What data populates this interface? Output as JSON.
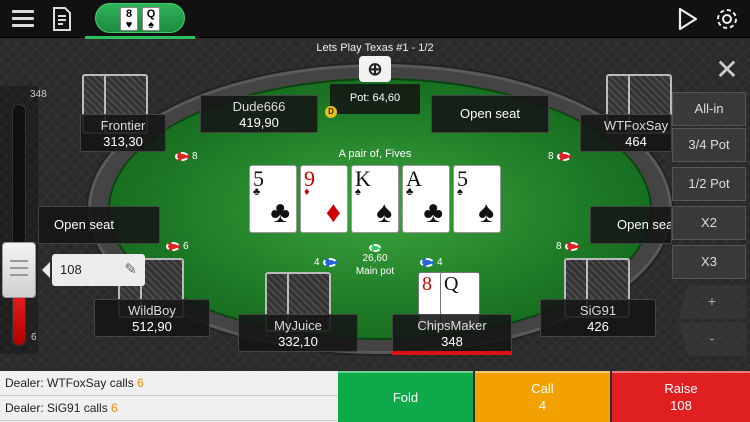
{
  "topbar": {
    "menu_icon": "hamburger-menu-icon",
    "history_icon": "hand-history-icon",
    "tab_cards": [
      {
        "rank": "8",
        "suit": "♥"
      },
      {
        "rank": "Q",
        "suit": "♠"
      }
    ],
    "play_icon": "play-icon",
    "settings_icon": "gear-icon"
  },
  "table_name": "Lets Play Texas #1 - 1/2",
  "slider": {
    "max": "348",
    "min": "6",
    "value": "108",
    "fill_fraction": 0.3
  },
  "pot": {
    "label": "Pot: 64,60"
  },
  "hand_description": "A pair of, Fives",
  "board": [
    {
      "rank": "5",
      "suit": "♣",
      "color": "#111111"
    },
    {
      "rank": "9",
      "suit": "♦",
      "color": "#d10000"
    },
    {
      "rank": "K",
      "suit": "♠",
      "color": "#111111"
    },
    {
      "rank": "A",
      "suit": "♣",
      "color": "#111111"
    },
    {
      "rank": "5",
      "suit": "♠",
      "color": "#111111"
    }
  ],
  "main_pot": {
    "amount": "26,60",
    "label": "Main pot"
  },
  "seats": {
    "frontier": {
      "name": "Frontier",
      "stack": "313,30",
      "bet": "8"
    },
    "dude666": {
      "name": "Dude666",
      "stack": "419,90"
    },
    "open_top": {
      "label": "Open seat"
    },
    "wtfoxsay": {
      "name": "WTFoxSay",
      "stack": "464",
      "bet": "8"
    },
    "open_left": {
      "label": "Open seat",
      "bet": "6"
    },
    "open_right": {
      "label": "Open seat",
      "bet": "8"
    },
    "wildboy": {
      "name": "WildBoy",
      "stack": "512,90"
    },
    "myjuice": {
      "name": "MyJuice",
      "stack": "332,10",
      "bet": "4"
    },
    "chipsmaker": {
      "name": "ChipsMaker",
      "stack": "348",
      "bet": "4"
    },
    "sig91": {
      "name": "SiG91",
      "stack": "426"
    }
  },
  "hero_cards": [
    {
      "rank": "8",
      "suit": "♥"
    },
    {
      "rank": "Q",
      "suit": "♠"
    }
  ],
  "dealer_button": "D",
  "side_buttons": {
    "all_in": "All-in",
    "three_quarter": "3/4 Pot",
    "half": "1/2 Pot",
    "x2": "X2",
    "x3": "X3",
    "plus": "+",
    "minus": "-"
  },
  "log": [
    {
      "text": "Dealer: WTFoxSay calls ",
      "amount": "6"
    },
    {
      "text": "Dealer: SiG91 calls ",
      "amount": "6"
    }
  ],
  "actions": {
    "fold": "Fold",
    "call_label": "Call",
    "call_amount": "4",
    "raise_label": "Raise",
    "raise_amount": "108"
  },
  "colors": {
    "fold": "#0eaa4a",
    "call": "#f2a100",
    "raise": "#e02020",
    "felt": "#1d7a26",
    "tab": "#2ec060"
  }
}
